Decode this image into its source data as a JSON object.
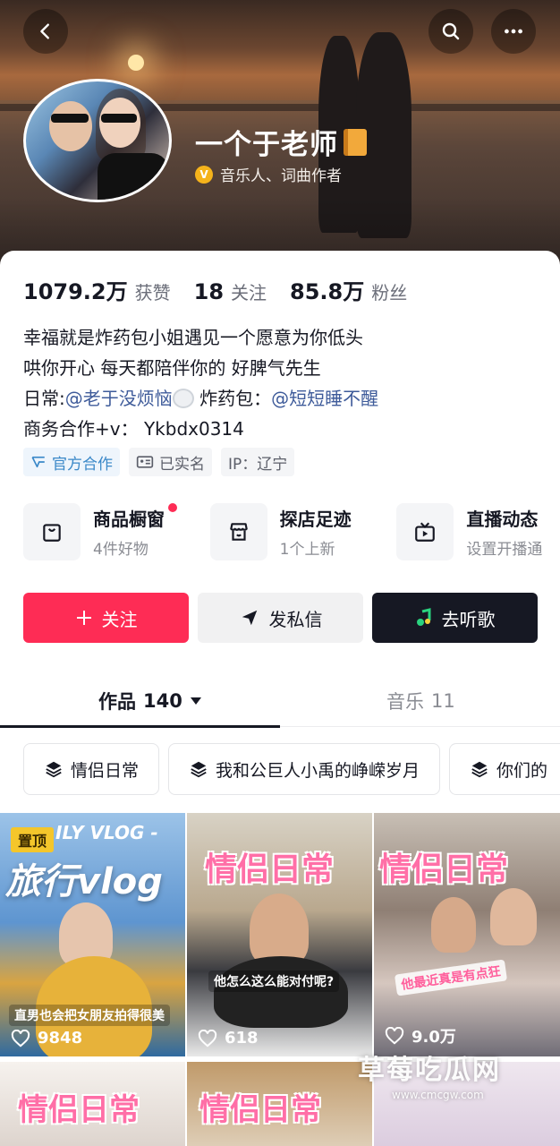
{
  "header": {
    "nickname": "一个于老师",
    "verify_text": "音乐人、词曲作者",
    "verify_badge": "V"
  },
  "stats": [
    {
      "value": "1079.2万",
      "label": "获赞"
    },
    {
      "value": "18",
      "label": "关注"
    },
    {
      "value": "85.8万",
      "label": "粉丝"
    }
  ],
  "bio": {
    "line1": "幸福就是炸药包小姐遇见一个愿意为你低头",
    "line2": "哄你开心 每天都陪伴你的 好脾气先生",
    "line3_prefix": "日常:",
    "line3_mention1": "@老于没烦恼",
    "line3_mid": " 炸药包：",
    "line3_mention2": "@短短睡不醒",
    "line4": "商务合作+v： Ykbdx0314"
  },
  "tags": [
    {
      "label": "官方合作",
      "icon": "official-icon"
    },
    {
      "label": "已实名",
      "icon": "id-card-icon"
    },
    {
      "label": "IP：辽宁",
      "icon": ""
    }
  ],
  "services": [
    {
      "title": "商品橱窗",
      "subtitle": "4件好物",
      "icon": "shopping-bag-icon",
      "has_dot": true
    },
    {
      "title": "探店足迹",
      "subtitle": "1个上新",
      "icon": "store-icon",
      "has_dot": false
    },
    {
      "title": "直播动态",
      "subtitle": "设置开播通",
      "icon": "tv-icon",
      "has_dot": false
    }
  ],
  "actions": {
    "follow": "关注",
    "message": "发私信",
    "music": "去听歌"
  },
  "tabs": {
    "works_label": "作品",
    "works_count": "140",
    "music_label": "音乐",
    "music_count": "11"
  },
  "collections": [
    {
      "label": "情侣日常"
    },
    {
      "label": "我和公巨人小禹的峥嵘岁月"
    },
    {
      "label": "你们的"
    }
  ],
  "videos": [
    {
      "pinned_label": "置顶",
      "title_top": "ILY VLOG -",
      "title": "旅行vlog",
      "caption": "直男也会把女朋友拍得很美",
      "likes": "9848"
    },
    {
      "title": "情侣日常",
      "caption": "他怎么这么能对付呢?",
      "likes": "618"
    },
    {
      "title": "情侣日常",
      "caption": "他最近真是有点狂",
      "likes": "9.0万"
    },
    {
      "title": "情侣日常"
    },
    {
      "title": "情侣日常"
    },
    {
      "title": ""
    }
  ],
  "watermark": {
    "text": "草莓吃瓜网",
    "url": "www.cmcgw.com"
  },
  "colors": {
    "accent_red": "#fe2c55",
    "dark": "#161823",
    "mention_blue": "#3e5b9a"
  }
}
